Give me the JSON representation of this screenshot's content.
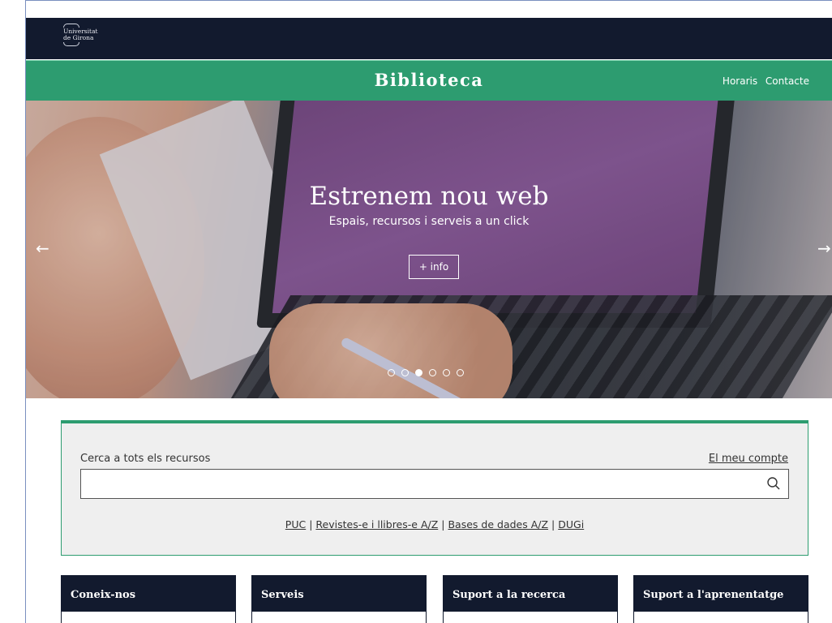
{
  "header": {
    "university_name_line1": "Universitat",
    "university_name_line2": "de Girona",
    "site_title": "Biblioteca",
    "links": [
      "Horaris",
      "Contacte"
    ]
  },
  "hero": {
    "title": "Estrenem nou web",
    "subtitle": "Espais, recursos i serveis a un click",
    "button_label": "+ info",
    "prev_arrow": "←",
    "next_arrow": "→",
    "slide_count": 6,
    "active_slide": 3
  },
  "search": {
    "label": "Cerca a tots els recursos",
    "account_link": "El meu compte",
    "input_value": "",
    "quick_links": [
      "PUC",
      "Revistes-e i llibres-e A/Z",
      "Bases de dades A/Z",
      "DUGi"
    ],
    "separator": "|"
  },
  "cards": [
    {
      "title": "Coneix-nos"
    },
    {
      "title": "Serveis"
    },
    {
      "title": "Suport a la recerca"
    },
    {
      "title": "Suport a l'aprenentatge"
    }
  ],
  "colors": {
    "dark_navy": "#121a2e",
    "green": "#2d9c70",
    "panel_grey": "#efefef"
  }
}
